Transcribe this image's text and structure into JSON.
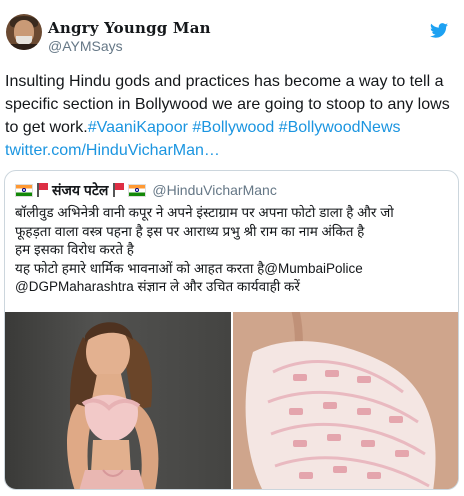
{
  "tweet": {
    "display_name": "Angry Youngg Man",
    "handle": "@AYMSays",
    "text_plain": "Insulting Hindu gods and practices has become a way to tell a specific section in Bollywood we are going to stoop to any lows to get work.",
    "hashtags": [
      "#VaaniKapoor",
      "#Bollywood",
      "#BollywoodNews"
    ],
    "link": "twitter.com/HinduVicharMan…"
  },
  "quoted": {
    "display_name": "संजय पटेल",
    "handle": "@HinduVicharManc",
    "lines": [
      "बॉलीवुड अभिनेत्री वानी कपूर ने अपने इंस्टाग्राम पर अपना फोटो डाला है और जो",
      "फूहड़ता वाला वस्त्र पहना है इस पर आराध्य प्रभु श्री राम का नाम अंकित है",
      "हम इसका विरोध करते है",
      "यह फोटो हमारे धार्मिक भावनाओं को आहत करता है@MumbaiPolice",
      "@DGPMaharashtra संज्ञान ले और उचित कार्यवाही करें"
    ]
  },
  "icons": {
    "avatar": "profile-avatar",
    "brand": "twitter-bird-icon",
    "flags": [
      "india-flag-icon",
      "red-flag-icon"
    ]
  },
  "colors": {
    "link": "#1b95e0",
    "secondary_text": "#657786",
    "border": "#ccd6dd",
    "twitter_blue": "#1da1f2"
  }
}
